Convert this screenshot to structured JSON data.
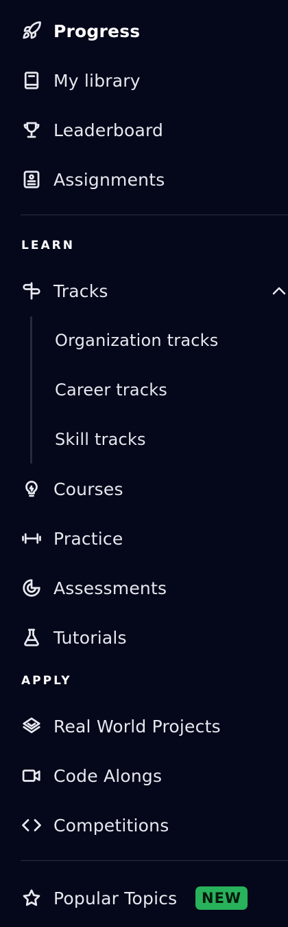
{
  "nav": {
    "progress": {
      "label": "Progress",
      "icon": "rocket-icon"
    },
    "my_library": {
      "label": "My library",
      "icon": "book-icon"
    },
    "leaderboard": {
      "label": "Leaderboard",
      "icon": "trophy-icon"
    },
    "assignments": {
      "label": "Assignments",
      "icon": "clipboard-icon"
    }
  },
  "learn": {
    "heading": "LEARN",
    "tracks": {
      "label": "Tracks",
      "icon": "signpost-icon",
      "expanded": true,
      "children": [
        {
          "label": "Organization tracks"
        },
        {
          "label": "Career tracks"
        },
        {
          "label": "Skill tracks"
        }
      ]
    },
    "courses": {
      "label": "Courses",
      "icon": "lightbulb-icon"
    },
    "practice": {
      "label": "Practice",
      "icon": "dumbbell-icon"
    },
    "assessments": {
      "label": "Assessments",
      "icon": "target-icon"
    },
    "tutorials": {
      "label": "Tutorials",
      "icon": "flask-icon"
    }
  },
  "apply": {
    "heading": "APPLY",
    "projects": {
      "label": "Real World Projects",
      "icon": "layers-icon"
    },
    "code_alongs": {
      "label": "Code Alongs",
      "icon": "video-camera-icon"
    },
    "competitions": {
      "label": "Competitions",
      "icon": "code-brackets-icon"
    }
  },
  "extra": {
    "popular_topics": {
      "label": "Popular Topics",
      "icon": "star-icon",
      "badge": "NEW",
      "badge_color": "#27b25b"
    }
  },
  "colors": {
    "background": "#05071a",
    "text": "#e7e9f0",
    "badge": "#27b25b"
  }
}
